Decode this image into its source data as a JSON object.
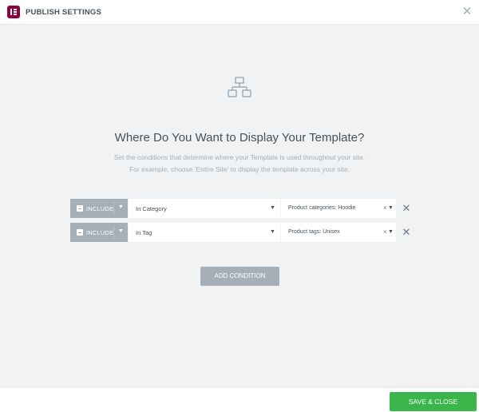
{
  "header": {
    "title": "PUBLISH SETTINGS",
    "close_symbol": "✕",
    "logo_icon": "elementor-logo-icon"
  },
  "main": {
    "hero_icon": "sitemap-icon",
    "heading": "Where Do You Want to Display Your Template?",
    "description_line1": "Set the conditions that determine where your Template is used throughout your site.",
    "description_line2": "For example, choose 'Entire Site' to display the template across your site."
  },
  "conditions": [
    {
      "type": "INCLUDE",
      "rule": "In Category",
      "value": "Product categories: Hoodie"
    },
    {
      "type": "INCLUDE",
      "rule": "In Tag",
      "value": "Product tags: Unisex"
    }
  ],
  "add_condition_label": "ADD CONDITION",
  "footer": {
    "save_label": "SAVE & CLOSE"
  },
  "colors": {
    "brand": "#92003b",
    "save": "#39b54a",
    "include": "#a4afb7"
  }
}
